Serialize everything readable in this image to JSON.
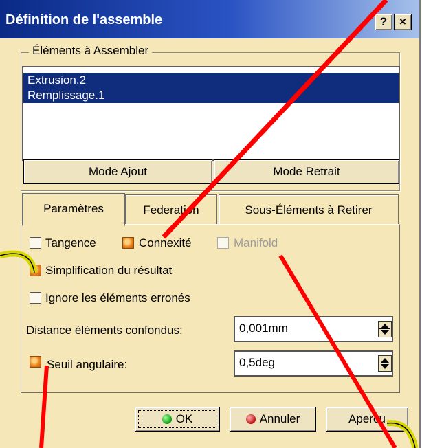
{
  "window": {
    "title": "Définition de l'assemble",
    "help_label": "?",
    "close_label": "×"
  },
  "elements_group": {
    "legend": "Éléments à Assembler",
    "items": [
      "Extrusion.2",
      "Remplissage.1"
    ],
    "mode_add_label": "Mode Ajout",
    "mode_remove_label": "Mode Retrait"
  },
  "tabs": [
    {
      "label": "Paramètres",
      "active": true
    },
    {
      "label": "Federation",
      "active": false
    },
    {
      "label": "Sous-Éléments à Retirer",
      "active": false
    }
  ],
  "parameters": {
    "tangence": {
      "label": "Tangence",
      "checked": false
    },
    "connexite": {
      "label": "Connexité",
      "checked": true
    },
    "manifold": {
      "label": "Manifold",
      "checked": false,
      "enabled": false
    },
    "simplification": {
      "label": "Simplification du résultat",
      "checked": true
    },
    "ignore_errors": {
      "label": "Ignore les éléments erronés",
      "checked": false
    },
    "distance": {
      "label": "Distance éléments confondus:",
      "value": "0,001mm"
    },
    "angular": {
      "label": "Seuil angulaire:",
      "value": "0,5deg",
      "checked": true
    }
  },
  "buttons": {
    "ok_label": "OK",
    "cancel_label": "Annuler",
    "preview_label": "Apercu"
  },
  "colors": {
    "dialog_bg": "#f6e7b9",
    "title_bar": "#0b2a86",
    "selection": "#102c7c",
    "annotation_red": "#ff0000",
    "annotation_hook": "#e6e200"
  }
}
